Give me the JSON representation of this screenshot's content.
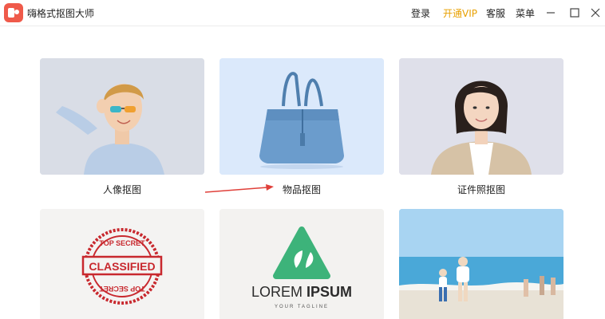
{
  "app": {
    "title": "嗨格式抠图大师"
  },
  "nav": {
    "login": "登录",
    "vip": "开通VIP",
    "service": "客服",
    "menu": "菜单"
  },
  "cards": [
    {
      "label": "人像抠图"
    },
    {
      "label": "物品抠图"
    },
    {
      "label": "证件照抠图"
    }
  ],
  "stamp": {
    "top": "TOP SECRET",
    "middle": "CLASSIFIED",
    "bottom": "TOP SECRET"
  },
  "logo": {
    "word1": "LOREM",
    "word2": "IPSUM",
    "tagline": "YOUR TAGLINE"
  },
  "colors": {
    "vip": "#e8a000",
    "arrow": "#e0403a",
    "stamp": "#c8282e",
    "logo_green": "#3db37a"
  }
}
